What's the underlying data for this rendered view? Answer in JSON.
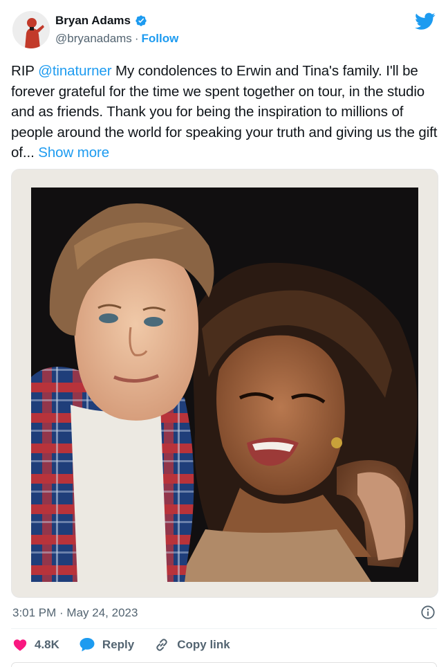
{
  "author": {
    "name": "Bryan Adams",
    "handle": "@bryanadams",
    "separator": "·",
    "follow_label": "Follow",
    "verified": true
  },
  "tweet": {
    "prefix": "RIP ",
    "mention": "@tinaturner",
    "body": " My condolences to Erwin and Tina's family. I'll be forever grateful for the time we spent together on tour, in the studio and as friends. Thank you for being the inspiration to millions of people around the world for speaking your truth and giving us the gift of... ",
    "show_more": "Show more"
  },
  "meta": {
    "timestamp": "3:01 PM · May 24, 2023"
  },
  "actions": {
    "likes": "4.8K",
    "reply": "Reply",
    "copy_link": "Copy link"
  },
  "icons": {
    "brand": "twitter-bird-icon",
    "verified": "verified-badge-icon",
    "info": "info-icon",
    "like": "heart-icon",
    "reply": "reply-bubble-icon",
    "link": "link-icon"
  },
  "colors": {
    "accent": "#1d9bf0",
    "like": "#f91880",
    "text": "#0f1419",
    "muted": "#536471"
  }
}
